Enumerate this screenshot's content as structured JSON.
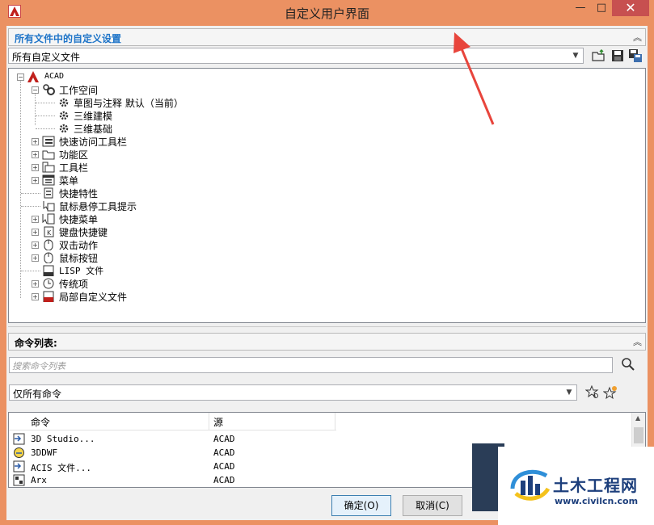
{
  "window": {
    "title": "自定义用户界面",
    "minimize": "—",
    "maximize": "□",
    "close": "✕"
  },
  "top_panel": {
    "title": "所有文件中的自定义设置",
    "collapse": "︽",
    "combo_value": "所有自定义文件"
  },
  "tree": {
    "root": "ACAD",
    "workspace": "工作空间",
    "workspace_children": [
      "草图与注释 默认（当前）",
      "三维建模",
      "三维基础"
    ],
    "nodes": [
      "快速访问工具栏",
      "功能区",
      "工具栏",
      "菜单",
      "快捷特性",
      "鼠标悬停工具提示",
      "快捷菜单",
      "键盘快捷键",
      "双击动作",
      "鼠标按钮",
      "LISP 文件",
      "传统项",
      "局部自定义文件"
    ]
  },
  "bottom_panel": {
    "title": "命令列表:",
    "collapse": "︽",
    "search_placeholder": "搜索命令列表",
    "filter_value": "仅所有命令",
    "columns": [
      "命令",
      "源"
    ],
    "rows": [
      {
        "name": "3D Studio...",
        "source": "ACAD"
      },
      {
        "name": "3DDWF",
        "source": "ACAD"
      },
      {
        "name": "ACIS 文件...",
        "source": "ACAD"
      },
      {
        "name": "Arx",
        "source": "ACAD"
      }
    ]
  },
  "buttons": {
    "ok": "确定(O)",
    "cancel": "取消(C)"
  },
  "watermark": {
    "brand": "土木工程网",
    "url": "www.civilcn.com"
  },
  "colors": {
    "titlebar": "#eb9162",
    "accent_text": "#1e74c8",
    "close": "#c75050",
    "arrow": "#e8453c"
  }
}
